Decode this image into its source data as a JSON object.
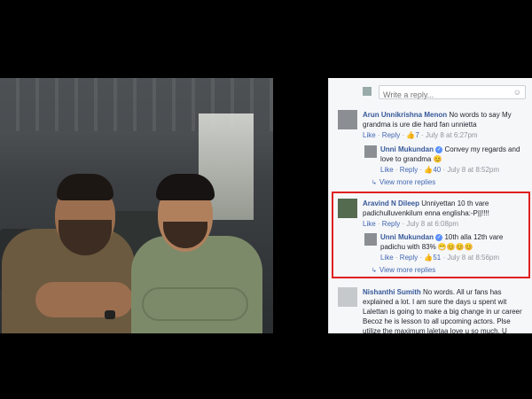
{
  "reply_placeholder": "Write a reply...",
  "comments": [
    {
      "name": "Arun Unnikrishna Menon",
      "text": "No words to say My grandma is ure die hard fan unnietta",
      "like": "Like",
      "reply": "Reply",
      "likes": "7",
      "time": "July 8 at 6:27pm"
    },
    {
      "name": "Unni Mukundan",
      "text": "Convey my regards and love to grandma 😊",
      "like": "Like",
      "reply": "Reply",
      "likes": "40",
      "time": "July 8 at 8:52pm",
      "view_more": "View more replies"
    },
    {
      "name": "Aravind N Dileep",
      "text": "Unniyettan 10 th vare padichulluvenkilum enna englisha:-P||!!!!",
      "like": "Like",
      "reply": "Reply",
      "time": "July 8 at 6:08pm"
    },
    {
      "name": "Unni Mukundan",
      "text": "10th alla 12th vare padichu with 83% 😁😊😊😊",
      "like": "Like",
      "reply": "Reply",
      "likes": "51",
      "time": "July 8 at 8:56pm",
      "view_more": "View more replies"
    },
    {
      "name": "Nishanthi Sumith",
      "text": "No words. All ur fans has explained a lot. I am sure the days u spent wit Lalettan is going to make a big change in ur career Becoz he is lesson to all upcoming actors. Plse utilize the maximum laletaa love u so much. U"
    }
  ],
  "colors": {
    "link": "#365899",
    "highlight": "#e02020"
  }
}
